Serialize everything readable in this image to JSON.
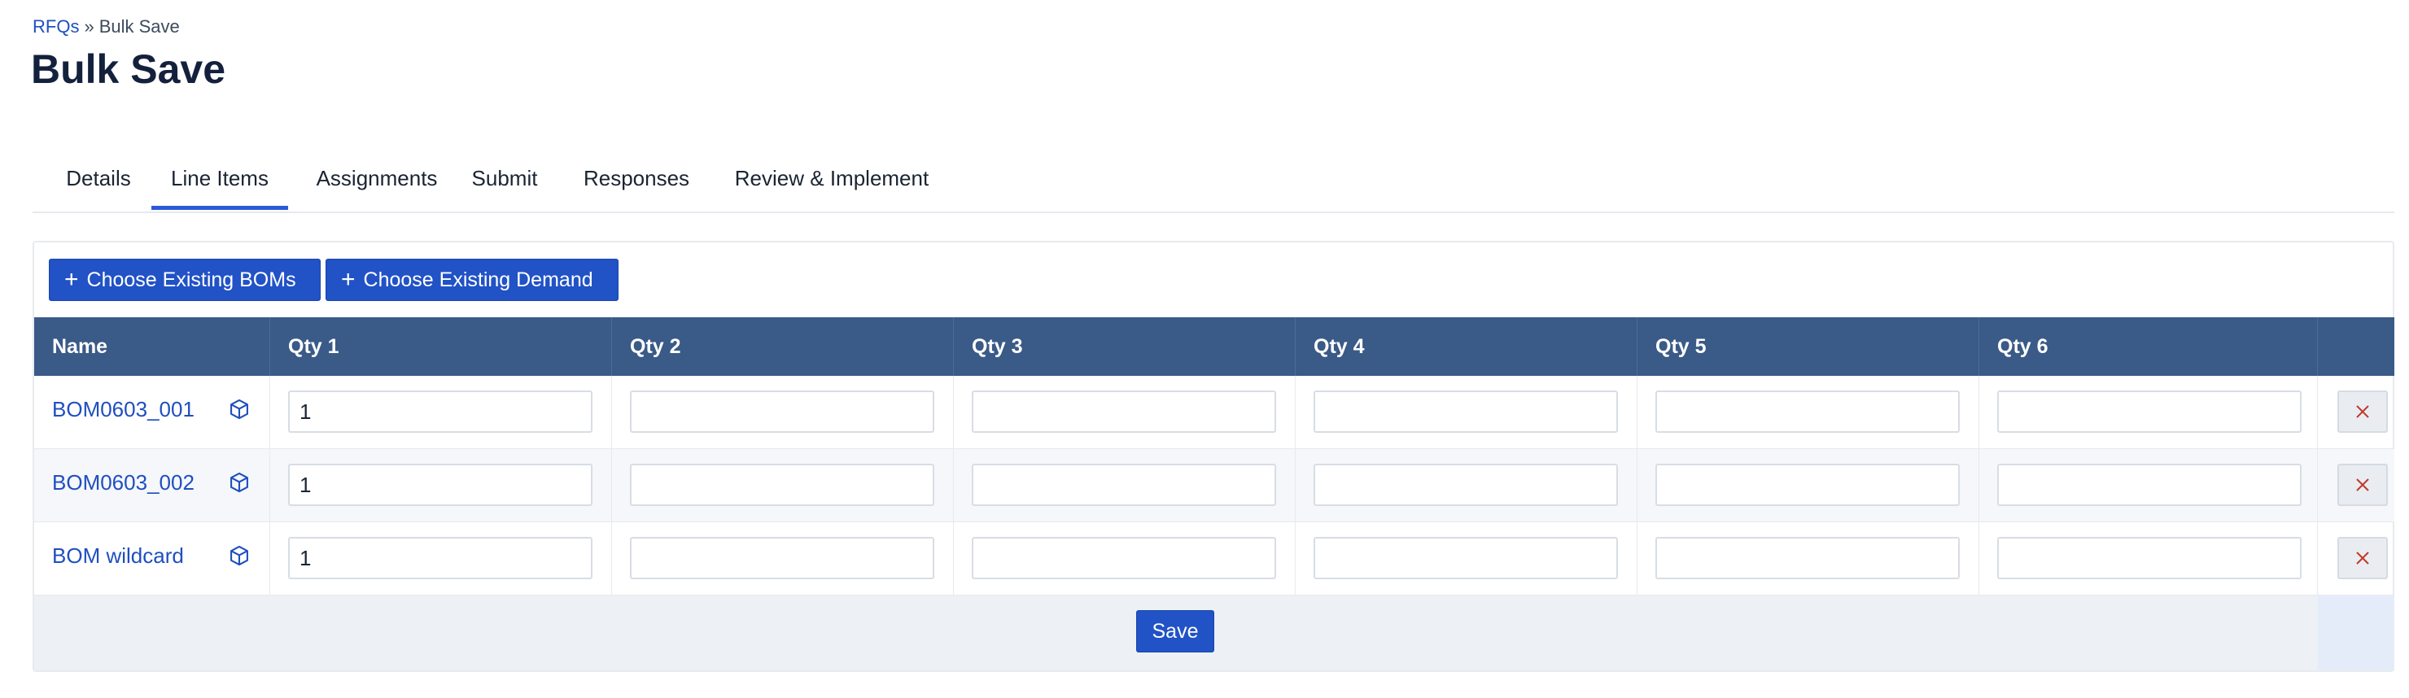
{
  "breadcrumb": {
    "root": "RFQs",
    "separator": "»",
    "current": "Bulk Save"
  },
  "page_title": "Bulk Save",
  "tabs": [
    {
      "label": "Details"
    },
    {
      "label": "Line Items"
    },
    {
      "label": "Assignments"
    },
    {
      "label": "Submit"
    },
    {
      "label": "Responses"
    },
    {
      "label": "Review & Implement"
    }
  ],
  "active_tab": "Line Items",
  "actions": {
    "choose_boms": "Choose Existing BOMs",
    "choose_demand": "Choose Existing Demand",
    "plus_icon": "plus-icon"
  },
  "table": {
    "columns": [
      "Name",
      "Qty 1",
      "Qty 2",
      "Qty 3",
      "Qty 4",
      "Qty 5",
      "Qty 6",
      ""
    ],
    "rows": [
      {
        "name": "BOM0603_001",
        "icon": "cube-icon",
        "qty": [
          "1",
          "",
          "",
          "",
          "",
          ""
        ]
      },
      {
        "name": "BOM0603_002",
        "icon": "cube-icon",
        "qty": [
          "1",
          "",
          "",
          "",
          "",
          ""
        ]
      },
      {
        "name": "BOM wildcard",
        "icon": "cube-icon",
        "qty": [
          "1",
          "",
          "",
          "",
          "",
          ""
        ]
      }
    ]
  },
  "save_label": "Save",
  "colors": {
    "primary": "#2152c6",
    "header": "#3a5a87",
    "link": "#1f4fbf",
    "delete": "#c0392b"
  }
}
